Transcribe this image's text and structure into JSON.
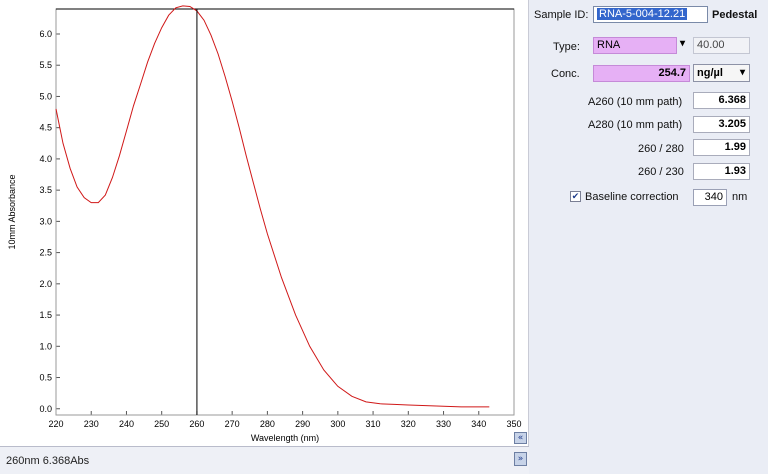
{
  "chart_data": {
    "type": "line",
    "xlabel": "Wavelength (nm)",
    "ylabel": "10mm Absorbance",
    "xlim": [
      220,
      350
    ],
    "ylim": [
      -0.1,
      6.4
    ],
    "x_ticks": [
      220,
      230,
      240,
      250,
      260,
      270,
      280,
      290,
      300,
      310,
      320,
      330,
      340,
      350
    ],
    "y_ticks": [
      "0.0",
      "0.5",
      "1.0",
      "1.5",
      "2.0",
      "2.5",
      "3.0",
      "3.5",
      "4.0",
      "4.5",
      "5.0",
      "5.5",
      "6.0"
    ],
    "cursor_x": 260,
    "grid": false,
    "series": [
      {
        "color": "#d01818",
        "x": [
          220,
          222,
          224,
          226,
          228,
          230,
          232,
          234,
          236,
          238,
          240,
          242,
          244,
          246,
          248,
          250,
          252,
          254,
          256,
          258,
          260,
          262,
          264,
          266,
          268,
          270,
          272,
          274,
          276,
          278,
          280,
          284,
          288,
          292,
          296,
          300,
          304,
          308,
          312,
          316,
          320,
          325,
          330,
          335,
          340,
          343
        ],
        "y": [
          4.8,
          4.25,
          3.85,
          3.55,
          3.38,
          3.3,
          3.3,
          3.42,
          3.7,
          4.05,
          4.45,
          4.85,
          5.2,
          5.55,
          5.85,
          6.1,
          6.3,
          6.42,
          6.45,
          6.44,
          6.37,
          6.22,
          5.98,
          5.68,
          5.32,
          4.92,
          4.5,
          4.05,
          3.62,
          3.2,
          2.8,
          2.1,
          1.5,
          1.0,
          0.62,
          0.36,
          0.2,
          0.11,
          0.08,
          0.07,
          0.06,
          0.05,
          0.04,
          0.03,
          0.03,
          0.03
        ]
      }
    ]
  },
  "status": {
    "text": "260nm 6.368Abs",
    "expand_icon": "double-chevron-down-icon",
    "collapse_icon": "double-chevron-left-icon"
  },
  "sample": {
    "id_label": "Sample ID:",
    "id_value": "RNA-5-004-12.21",
    "mode": "Pedestal",
    "type_label": "Type:",
    "type_value": "RNA",
    "type_factor": "40.00",
    "conc_label": "Conc.",
    "conc_value": "254.7",
    "conc_unit": "ng/µl",
    "a260_label": "A260 (10 mm path)",
    "a260_value": "6.368",
    "a280_label": "A280 (10 mm path)",
    "a280_value": "3.205",
    "r260_280_label": "260 / 280",
    "r260_280_value": "1.99",
    "r260_230_label": "260 / 230",
    "r260_230_value": "1.93",
    "baseline_label": "Baseline correction",
    "baseline_value": "340",
    "baseline_unit": "nm",
    "baseline_checked": true
  },
  "colors": {
    "highlight": "#e6b0f5",
    "selection": "#3366cc",
    "trace": "#d01818",
    "panel": "#eaedf5"
  }
}
